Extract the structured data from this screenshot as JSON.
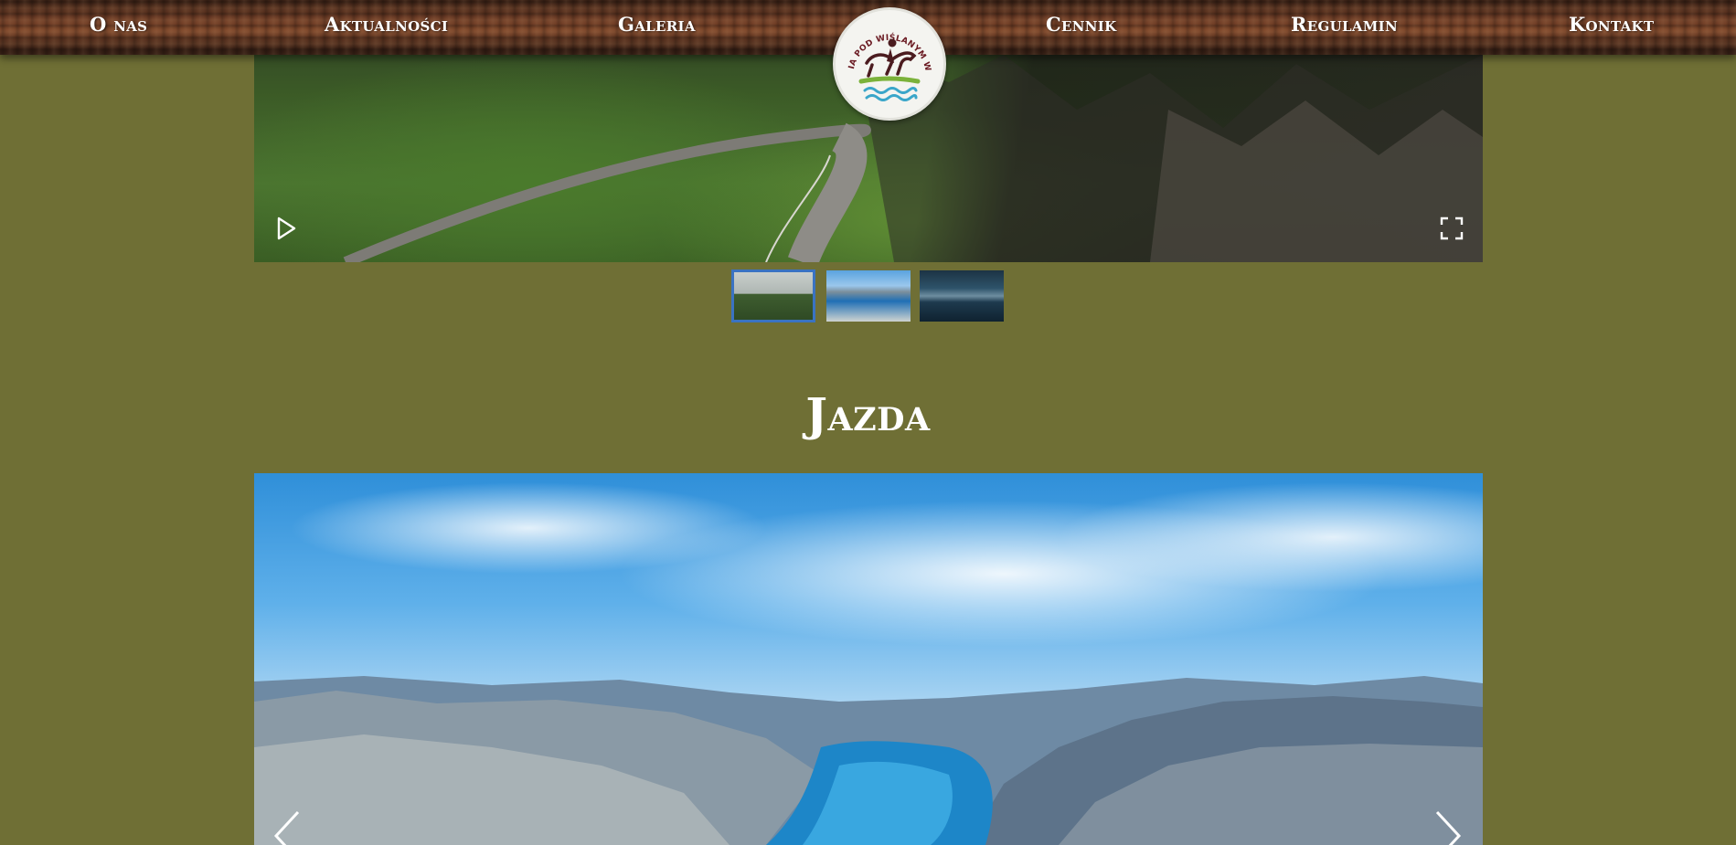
{
  "nav": {
    "items": [
      {
        "label": "O nas"
      },
      {
        "label": "Aktualności"
      },
      {
        "label": "Galeria"
      },
      {
        "label": "Cennik"
      },
      {
        "label": "Regulamin"
      },
      {
        "label": "Kontakt"
      }
    ]
  },
  "logo": {
    "text": "STAJNIA POD WIŚLANYM WAŁEM",
    "icon": "horse-rider-icon"
  },
  "gallery_top": {
    "controls": {
      "play_icon": "play-icon",
      "fullscreen_icon": "fullscreen-icon"
    },
    "thumbnails": [
      {
        "selected": true
      },
      {
        "selected": false
      },
      {
        "selected": false
      }
    ]
  },
  "section": {
    "title": "Jazda"
  },
  "gallery_bottom": {
    "controls": {
      "prev_icon": "chevron-left-icon",
      "next_icon": "chevron-right-icon"
    }
  },
  "colors": {
    "page_background": "#6f6f35",
    "nav_text": "#ffffff",
    "thumbnail_selected_border": "#3a73c2"
  }
}
